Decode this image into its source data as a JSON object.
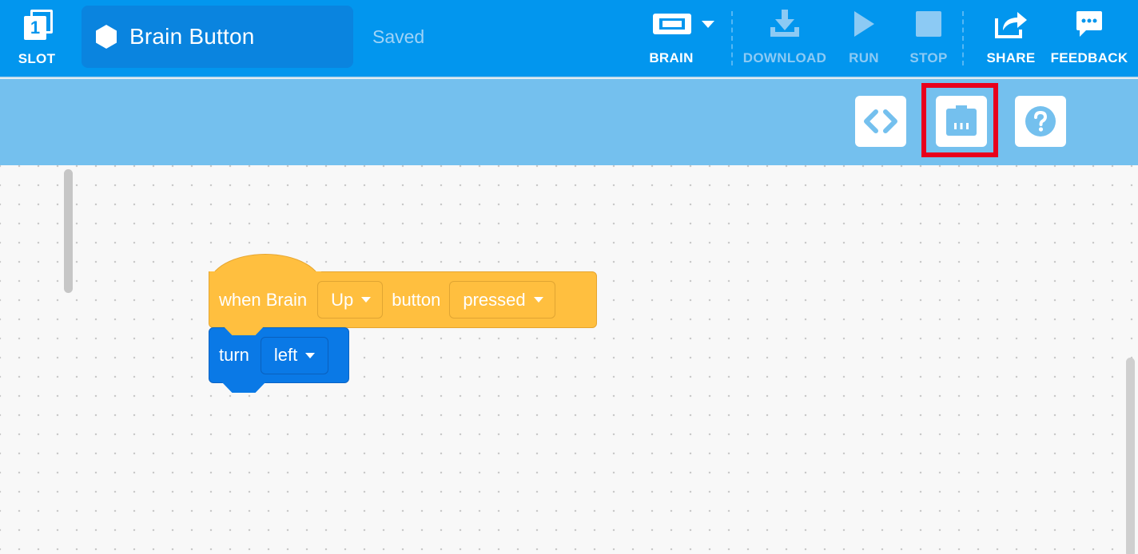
{
  "header": {
    "slot": {
      "number": "1",
      "label": "SLOT"
    },
    "project_name": "Brain Button",
    "save_status": "Saved",
    "device_label": "BRAIN",
    "download_label": "DOWNLOAD",
    "run_label": "RUN",
    "stop_label": "STOP",
    "share_label": "SHARE",
    "feedback_label": "FEEDBACK"
  },
  "toolbar": {
    "tools": [
      "code-view-icon",
      "device-info-icon",
      "help-icon"
    ],
    "highlighted_tool": "device-info-icon"
  },
  "blocks": {
    "hat": {
      "prefix": "when Brain",
      "button_value": "Up",
      "middle": "button",
      "action_value": "pressed"
    },
    "turn": {
      "label": "turn",
      "direction_value": "left"
    }
  },
  "colors": {
    "header_bg": "#0296ee",
    "subbar_bg": "#74c0ee",
    "event_block": "#ffbf3f",
    "motion_block": "#0a79e6",
    "highlight": "#e8001c"
  }
}
